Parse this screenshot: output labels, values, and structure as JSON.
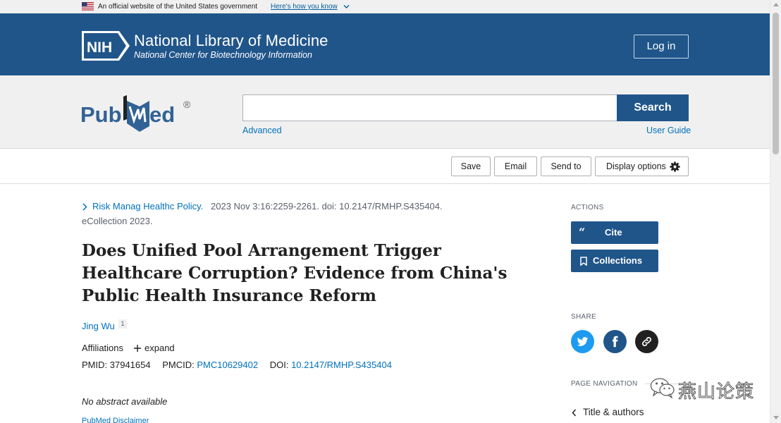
{
  "gov_banner": {
    "text": "An official website of the United States government",
    "link": "Here's how you know"
  },
  "header": {
    "logo_text": "NIH",
    "title": "National Library of Medicine",
    "subtitle": "National Center for Biotechnology Information",
    "login_label": "Log in"
  },
  "search": {
    "logo_text_left": "Pub",
    "logo_text_right": "ed",
    "logo_mark": "®",
    "query": "",
    "button_label": "Search",
    "advanced_label": "Advanced",
    "user_guide_label": "User Guide"
  },
  "toolbar": {
    "save_label": "Save",
    "email_label": "Email",
    "send_label": "Send to",
    "display_label": "Display options"
  },
  "article": {
    "journal": "Risk Manag Healthc Policy.",
    "citation_rest": "2023 Nov 3:16:2259-2261. doi: 10.2147/RMHP.S435404.",
    "citation_line2": "eCollection 2023.",
    "title": "Does Unified Pool Arrangement Trigger Healthcare Corruption? Evidence from China's Public Health Insurance Reform",
    "author": "Jing Wu",
    "author_sup": "1",
    "affiliations_label": "Affiliations",
    "expand_label": "expand",
    "pmid_label": "PMID:",
    "pmid": "37941654",
    "pmcid_label": "PMCID:",
    "pmcid": "PMC10629402",
    "doi_label": "DOI:",
    "doi": "10.2147/RMHP.S435404",
    "no_abstract": "No abstract available",
    "disclaimer": "PubMed Disclaimer"
  },
  "sidebar": {
    "actions_heading": "ACTIONS",
    "cite_label": "Cite",
    "collections_label": "Collections",
    "share_heading": "SHARE",
    "share_icons": [
      "twitter-icon",
      "facebook-icon",
      "link-icon"
    ],
    "page_nav_heading": "PAGE NAVIGATION",
    "nav_item": "Title & authors"
  },
  "watermark": {
    "text": "燕山论策"
  },
  "colors": {
    "nih_blue": "#20558a",
    "link_blue": "#0071bc",
    "banner_gray": "#f0f0f0",
    "twitter_blue": "#1d9bf0"
  }
}
